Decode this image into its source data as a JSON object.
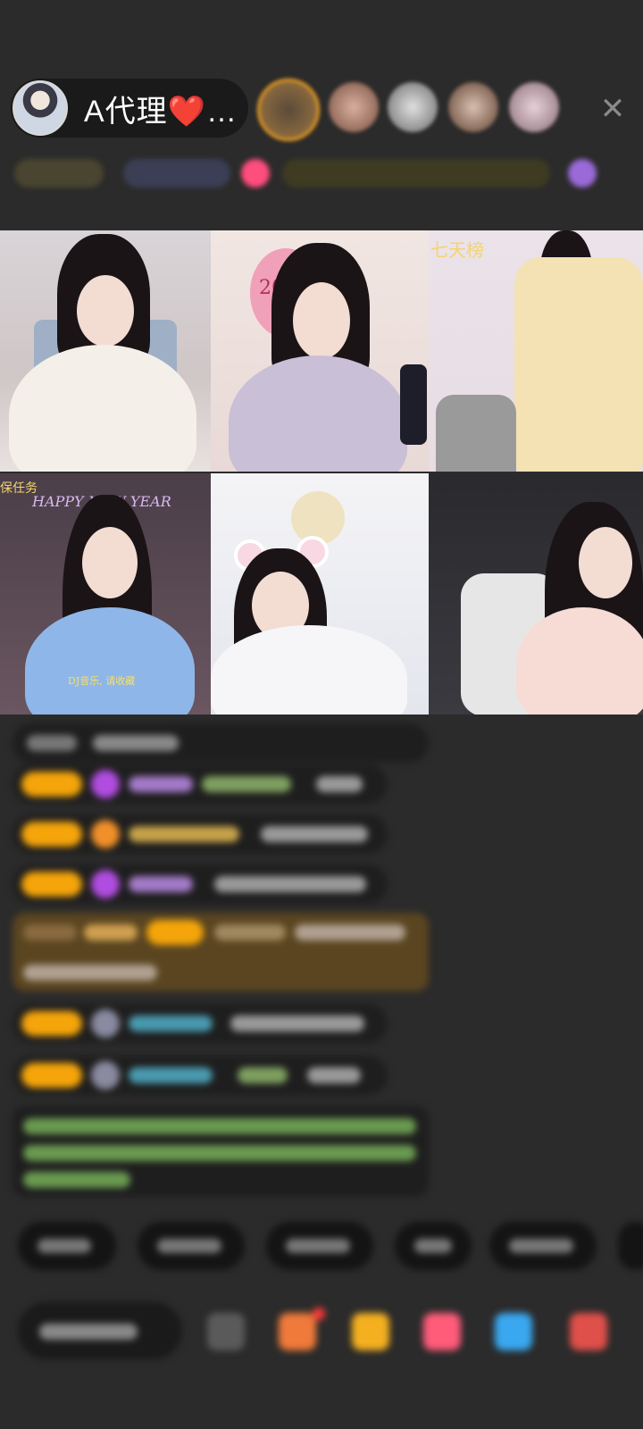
{
  "header": {
    "host_name": "A代理❤️…",
    "close_symbol": "✕"
  },
  "video_grid": {
    "tile_3_label": "七天榜",
    "tile_4_label": "保任务",
    "tile_4_sign": "HAPPY NEW YEAR",
    "tile_4_caption": "DJ音乐, 请收藏",
    "tile_2_balloon": "2026"
  },
  "icons": {
    "close": "close-icon",
    "host_avatar": "avatar",
    "gift": "gift-icon"
  },
  "colors": {
    "background": "#2b2b2b",
    "badge": "#f5a50a",
    "accent_pink": "#ff5c7a"
  }
}
